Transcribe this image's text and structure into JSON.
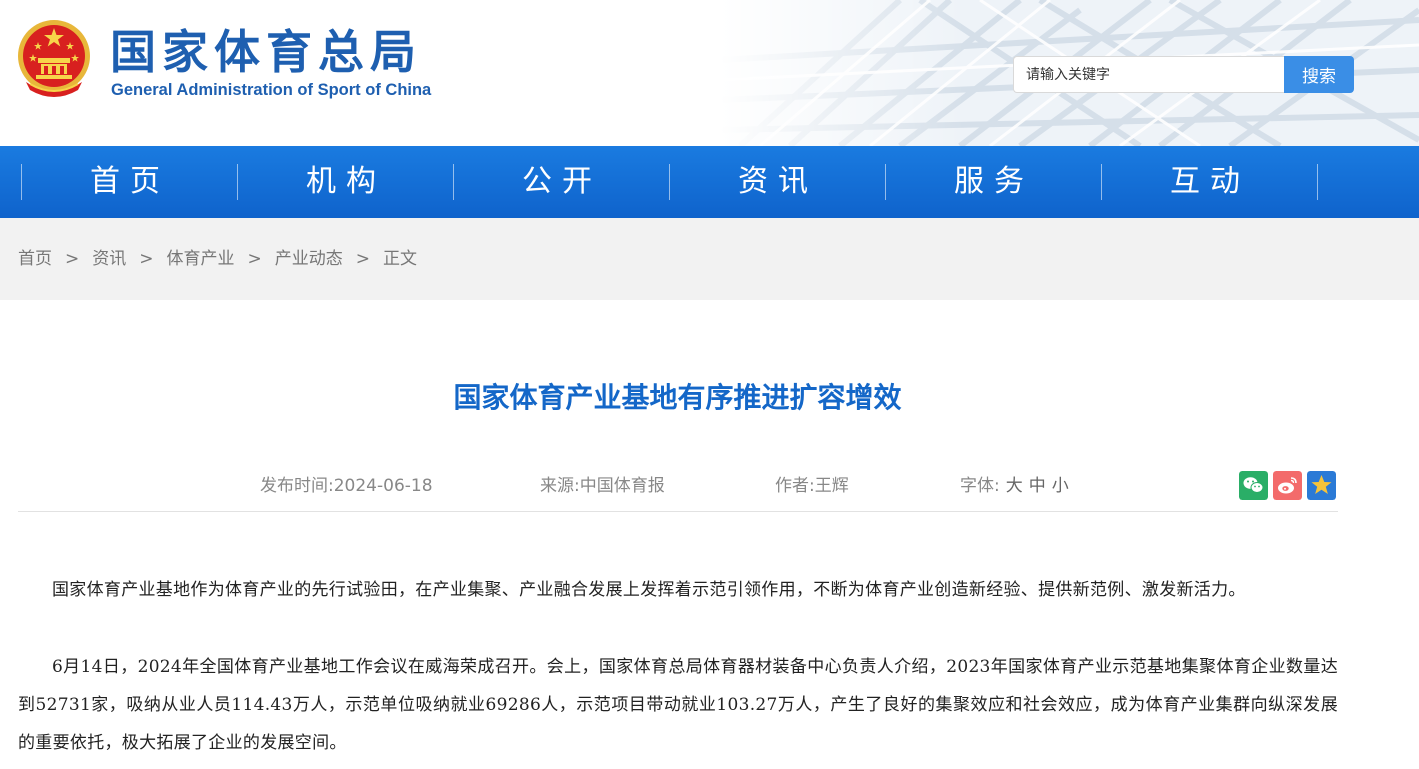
{
  "header": {
    "logo_cn": "国家体育总局",
    "logo_en": "General Administration of Sport of China",
    "search_placeholder": "请输入关键字",
    "search_button": "搜索"
  },
  "nav": [
    "首页",
    "机构",
    "公开",
    "资讯",
    "服务",
    "互动"
  ],
  "breadcrumb": {
    "items": [
      "首页",
      "资讯",
      "体育产业",
      "产业动态",
      "正文"
    ],
    "separator": ">"
  },
  "article": {
    "title": "国家体育产业基地有序推进扩容增效",
    "publish_label": "发布时间:",
    "publish_date": "2024-06-18",
    "source_label": "来源:",
    "source": "中国体育报",
    "author_label": "作者:",
    "author": "王辉",
    "font_label": "字体:",
    "font_sizes": [
      "大",
      "中",
      "小"
    ],
    "paragraphs": [
      "国家体育产业基地作为体育产业的先行试验田，在产业集聚、产业融合发展上发挥着示范引领作用，不断为体育产业创造新经验、提供新范例、激发新活力。",
      "6月14日，2024年全国体育产业基地工作会议在威海荣成召开。会上，国家体育总局体育器材装备中心负责人介绍，2023年国家体育产业示范基地集聚体育企业数量达到52731家，吸纳从业人员114.43万人，示范单位吸纳就业69286人，示范项目带动就业103.27万人，产生了良好的集聚效应和社会效应，成为体育产业集群向纵深发展的重要依托，极大拓展了企业的发展空间。"
    ]
  },
  "share_icons": [
    {
      "name": "wechat-icon",
      "color": "#2aae67"
    },
    {
      "name": "weibo-icon",
      "color": "#f36b6b"
    },
    {
      "name": "favorite-star-icon",
      "color": "#2b7ad6"
    }
  ],
  "colors": {
    "brand_blue": "#1e5fb0",
    "nav_blue": "#1173d9",
    "title_blue": "#1467c8",
    "search_button": "#3a8ee6"
  }
}
